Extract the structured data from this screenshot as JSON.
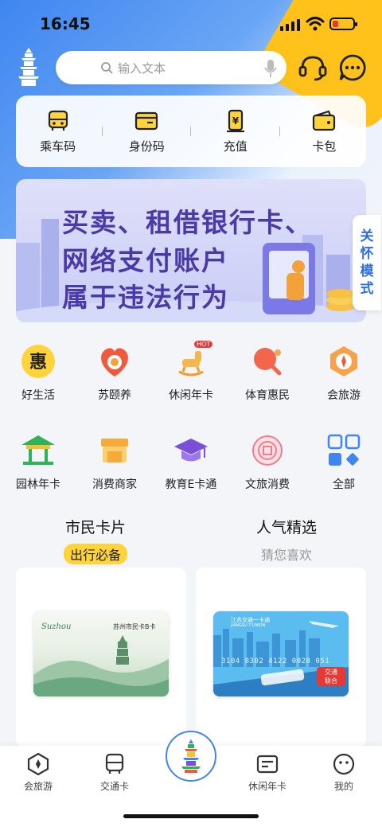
{
  "status": {
    "time": "16:45"
  },
  "search": {
    "placeholder": "输入文本"
  },
  "quick_actions": [
    {
      "label": "乘车码",
      "icon": "bus-icon"
    },
    {
      "label": "身份码",
      "icon": "id-card-icon"
    },
    {
      "label": "充值",
      "icon": "recharge-icon"
    },
    {
      "label": "卡包",
      "icon": "wallet-icon"
    }
  ],
  "banner": {
    "line1": "买卖、租借银行卡、",
    "line2": "网络支付账户",
    "line3": "属于违法行为"
  },
  "care_mode": {
    "label": [
      "关",
      "怀",
      "模",
      "式"
    ]
  },
  "services_row1": [
    {
      "label": "好生活",
      "icon": "hui-icon"
    },
    {
      "label": "苏颐养",
      "icon": "elder-care-icon"
    },
    {
      "label": "休闲年卡",
      "icon": "rocking-horse-icon",
      "badge": "HOT"
    },
    {
      "label": "体育惠民",
      "icon": "ping-pong-icon"
    },
    {
      "label": "会旅游",
      "icon": "compass-icon"
    }
  ],
  "services_row2": [
    {
      "label": "园林年卡",
      "icon": "pavilion-icon"
    },
    {
      "label": "消费商家",
      "icon": "shop-icon"
    },
    {
      "label": "教育E卡通",
      "icon": "graduation-cap-icon"
    },
    {
      "label": "文旅消费",
      "icon": "culture-icon"
    },
    {
      "label": "全部",
      "icon": "all-apps-icon"
    }
  ],
  "sections": {
    "left": {
      "title": "市民卡片",
      "subtitle": "出行必备"
    },
    "right": {
      "title": "人气精选",
      "subtitle": "猜您喜欢"
    }
  },
  "cards": {
    "card1": {
      "name": "苏州市民卡B卡",
      "brand": "Suzhou"
    },
    "card2": {
      "name": "江苏交通一卡通",
      "name_en": "JIANGSU T-UNION",
      "number": "3104 8302 4122 0028 051",
      "badge_top": "交通",
      "badge_bottom": "联合"
    }
  },
  "tabbar": [
    {
      "label": "会旅游",
      "icon": "compass-icon"
    },
    {
      "label": "交通卡",
      "icon": "bus-icon"
    },
    {
      "label": "休闲年卡",
      "icon": "card-icon"
    },
    {
      "label": "我的",
      "icon": "smile-icon"
    }
  ],
  "colors": {
    "primary": "#3f86f0",
    "accent_yellow": "#ffc21a",
    "banner_text": "#4a3aa8"
  }
}
